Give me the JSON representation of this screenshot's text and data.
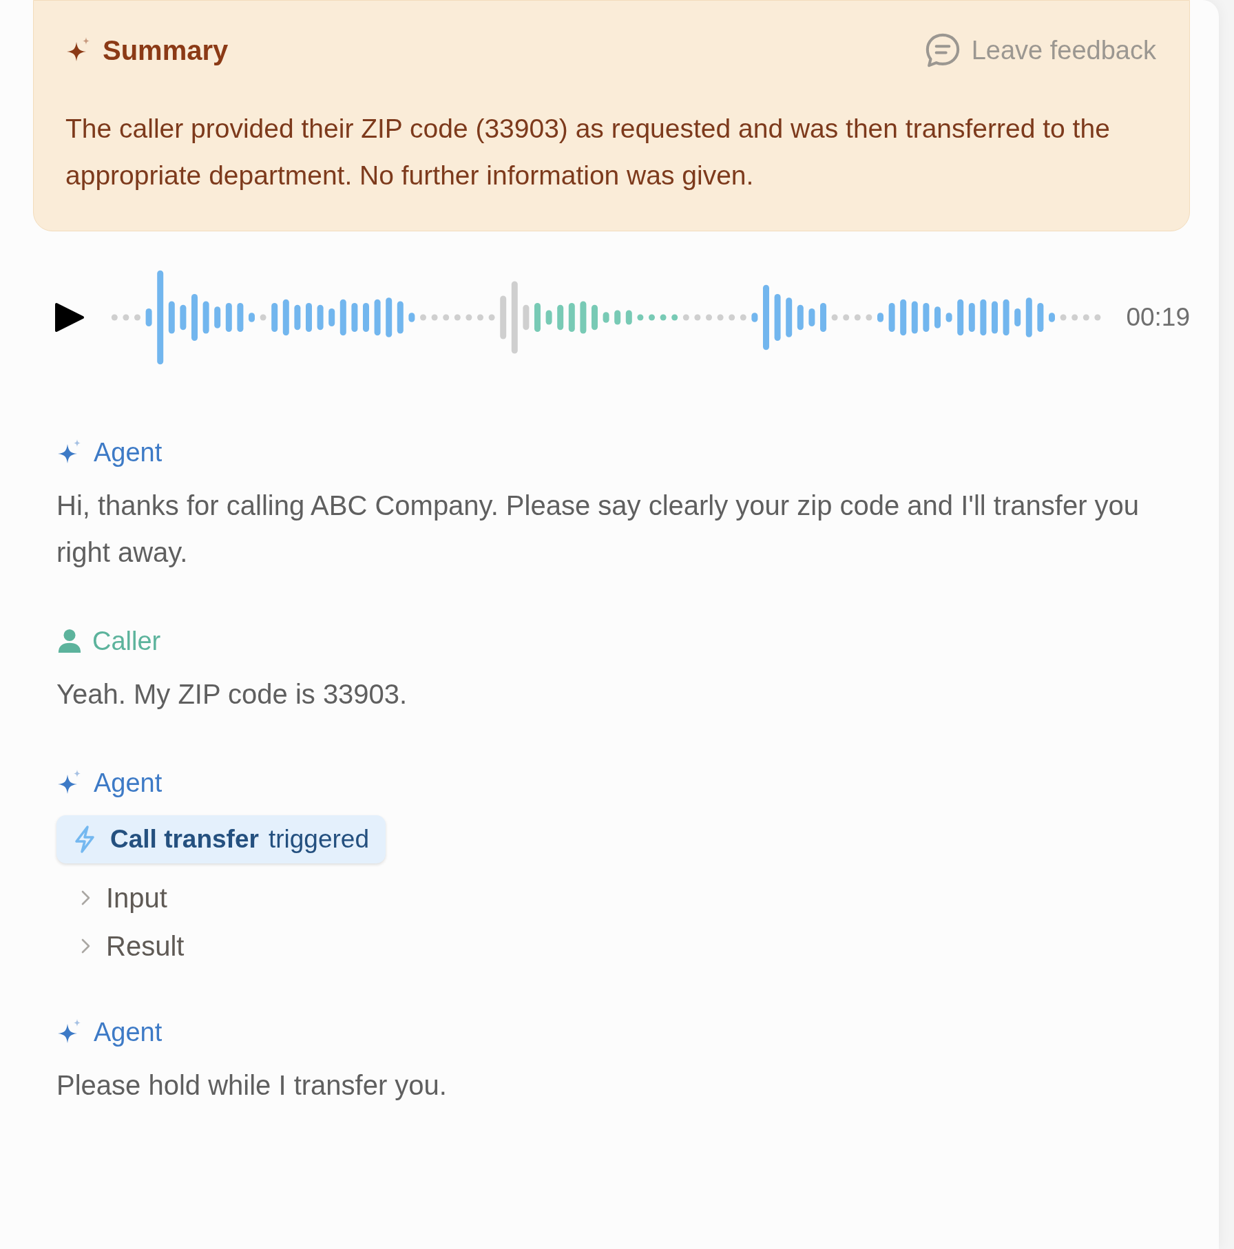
{
  "summary": {
    "title": "Summary",
    "feedback": "Leave feedback",
    "text": "The caller provided their ZIP code (33903) as requested and was then transferred to the appropriate department. No further information was given."
  },
  "player": {
    "time": "00:19"
  },
  "transcript": [
    {
      "speaker": "Agent",
      "kind": "agent",
      "text": "Hi, thanks for calling ABC Company. Please say clearly your zip code and I'll transfer you right away."
    },
    {
      "speaker": "Caller",
      "kind": "caller",
      "text": "Yeah. My ZIP code is 33903."
    },
    {
      "speaker": "Agent",
      "kind": "agent",
      "tool": {
        "name": "Call transfer",
        "status": "triggered",
        "details": [
          {
            "label": "Input",
            "expanded": false
          },
          {
            "label": "Result",
            "expanded": false
          }
        ]
      }
    },
    {
      "speaker": "Agent",
      "kind": "agent",
      "text": "Please hold while I transfer you."
    }
  ]
}
